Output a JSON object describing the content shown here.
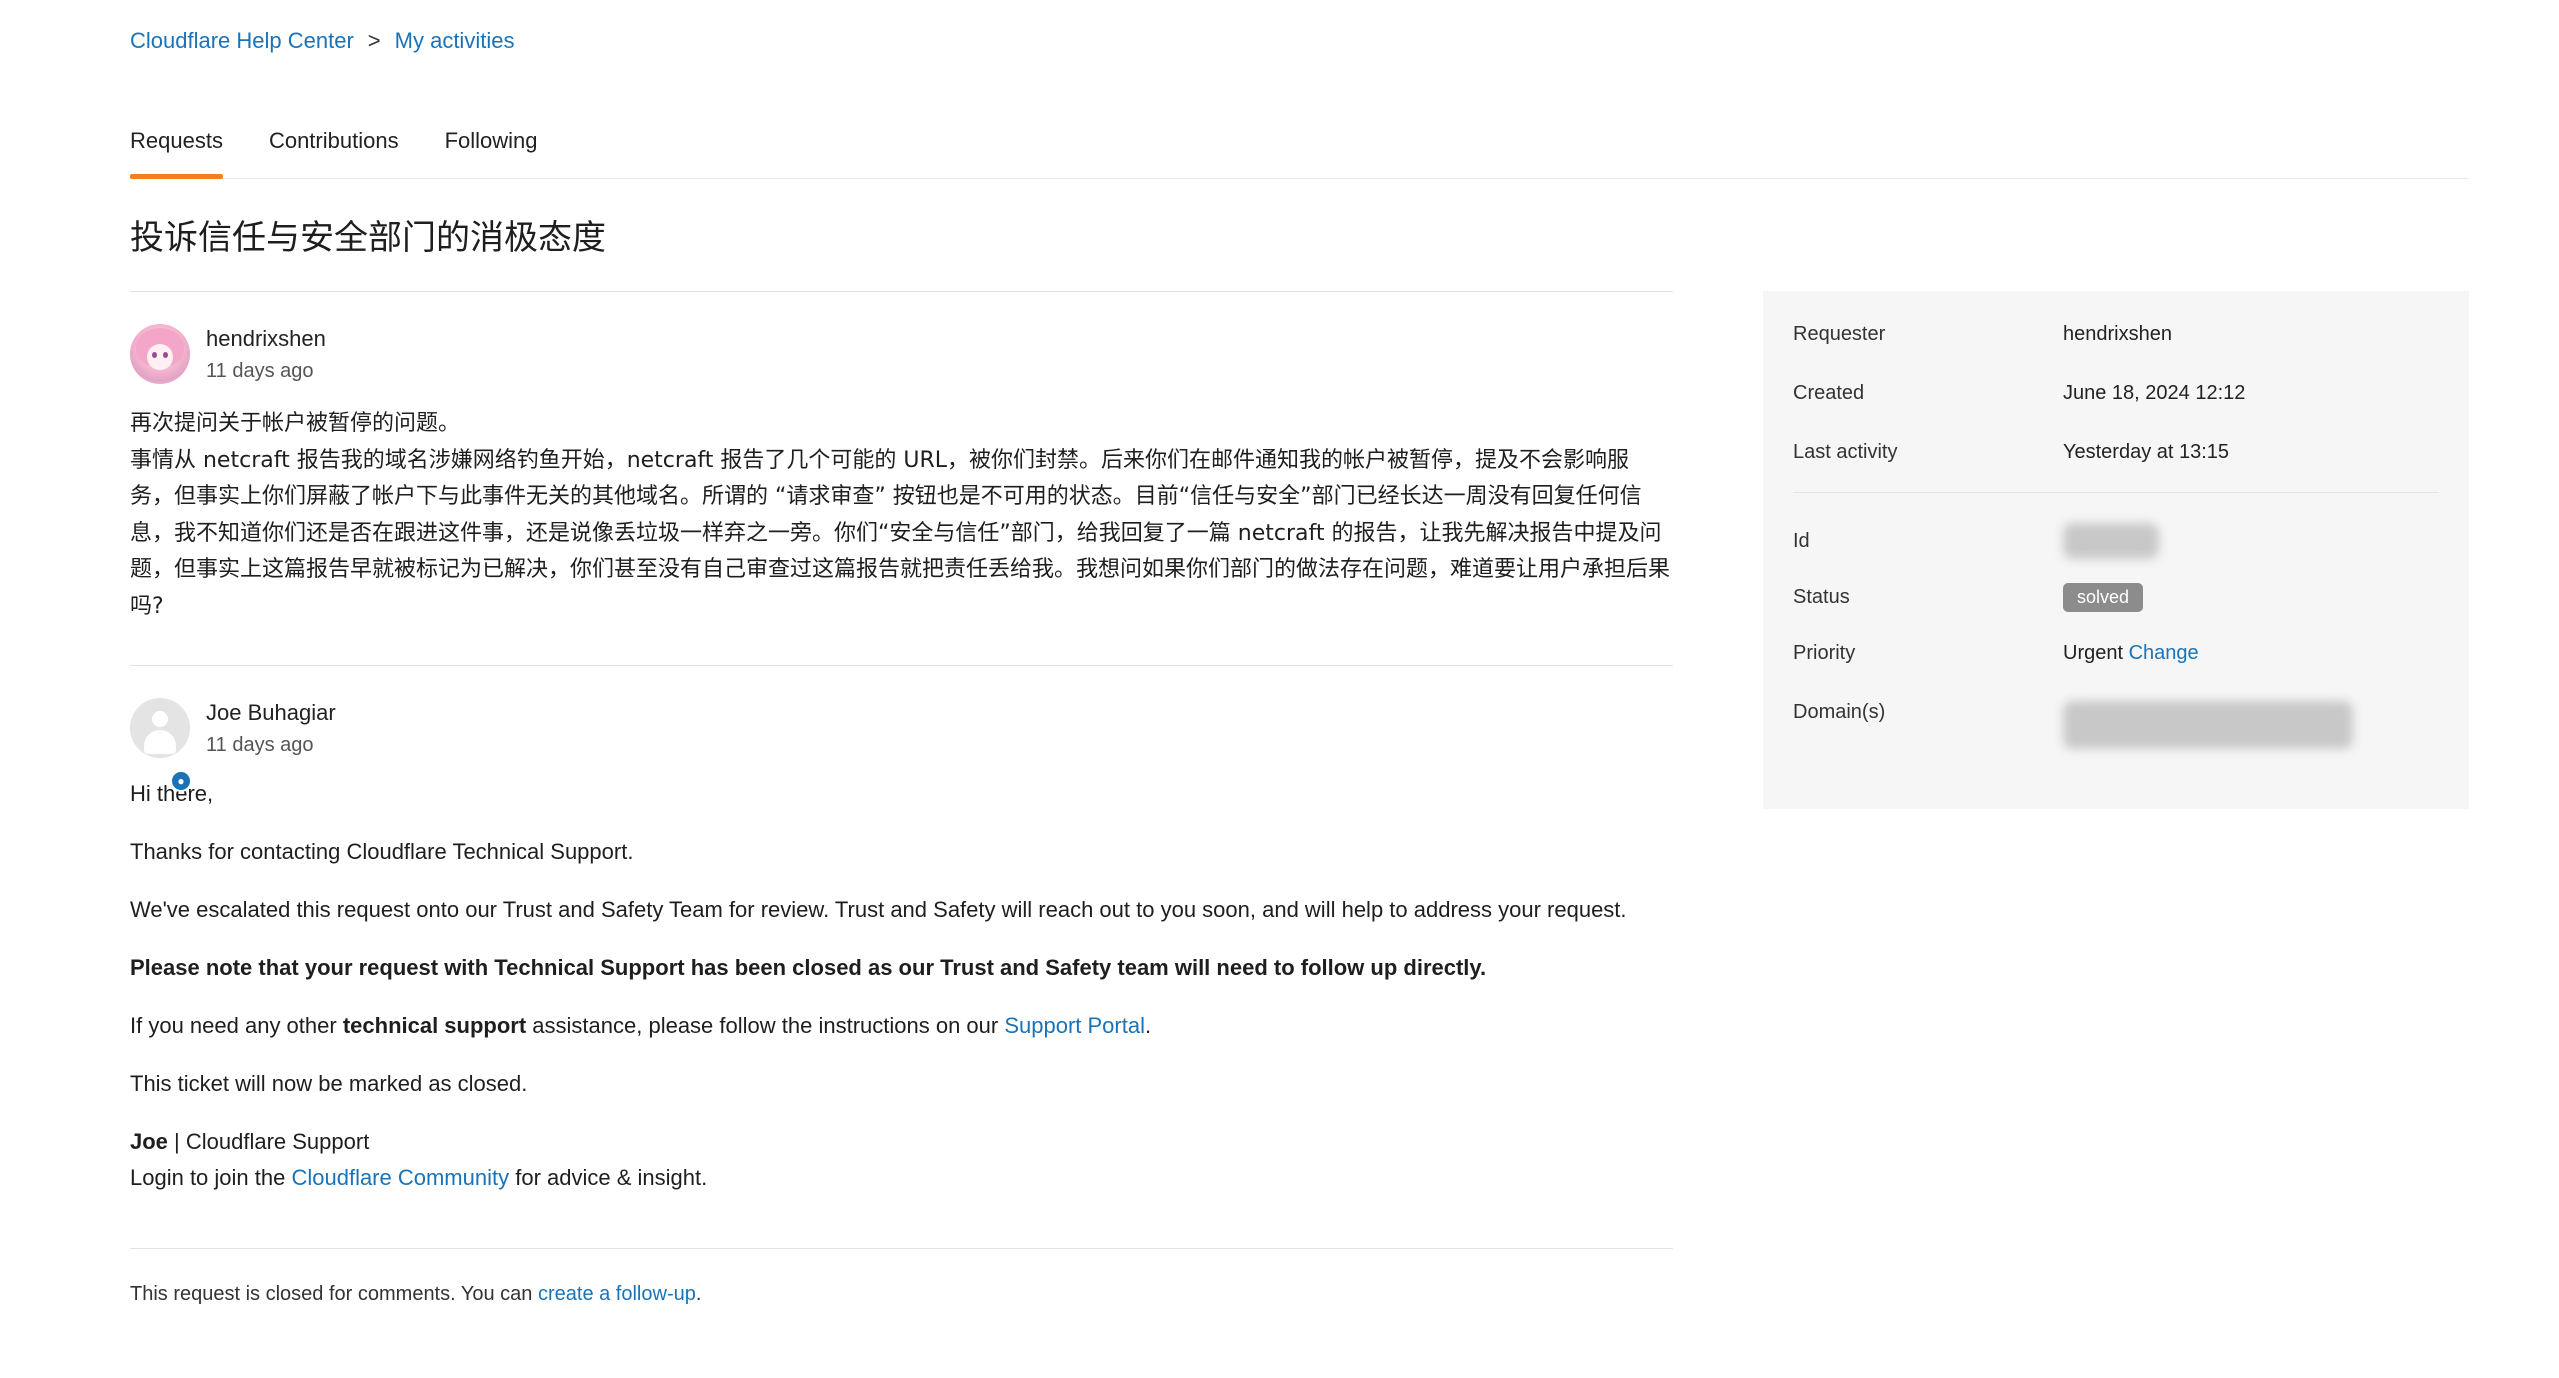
{
  "breadcrumb": {
    "home": "Cloudflare Help Center",
    "sep": ">",
    "current": "My activities"
  },
  "tabs": [
    {
      "label": "Requests",
      "active": true
    },
    {
      "label": "Contributions",
      "active": false
    },
    {
      "label": "Following",
      "active": false
    }
  ],
  "request": {
    "title": "投诉信任与安全部门的消极态度"
  },
  "comments": [
    {
      "author": "hendrixshen",
      "time": "11 days ago",
      "paragraphs": [
        "再次提问关于帐户被暂停的问题。",
        "事情从 netcraft 报告我的域名涉嫌网络钓鱼开始，netcraft 报告了几个可能的 URL，被你们封禁。后来你们在邮件通知我的帐户被暂停，提及不会影响服务，但事实上你们屏蔽了帐户下与此事件无关的其他域名。所谓的 “请求审查” 按钮也是不可用的状态。目前“信任与安全”部门已经长达一周没有回复任何信息，我不知道你们还是否在跟进这件事，还是说像丢垃圾一样弃之一旁。你们“安全与信任”部门，给我回复了一篇 netcraft 的报告，让我先解决报告中提及问题，但事实上这篇报告早就被标记为已解决，你们甚至没有自己审查过这篇报告就把责任丢给我。我想问如果你们部门的做法存在问题，难道要让用户承担后果吗?"
      ]
    },
    {
      "author": "Joe Buhagiar",
      "time": "11 days ago",
      "greeting": "Hi there,",
      "thanks": "Thanks for contacting Cloudflare Technical Support.",
      "escalation": "We've escalated this request onto our Trust and Safety Team for review. Trust and Safety will reach out to you soon, and will help to address your request.",
      "note_bold": "Please note that your request with Technical Support has been closed as our Trust and Safety team will need to follow up directly.",
      "assist_pre": "If you need any other ",
      "assist_bold": "technical support",
      "assist_mid": " assistance, please follow the instructions on our ",
      "assist_link": "Support Portal",
      "assist_end": ".",
      "marked": "This ticket will now be marked as closed.",
      "sig_name": "Joe",
      "sig_rest": " | Cloudflare Support",
      "join_pre": "Login to join the ",
      "join_link": "Cloudflare Community",
      "join_end": " for advice & insight."
    }
  ],
  "closed_note": {
    "text": "This request is closed for comments. You can ",
    "link": "create a follow-up",
    "end": "."
  },
  "sidebar": {
    "requester_label": "Requester",
    "requester": "hendrixshen",
    "created_label": "Created",
    "created": "June 18, 2024 12:12",
    "last_label": "Last activity",
    "last": "Yesterday at 13:15",
    "id_label": "Id",
    "status_label": "Status",
    "status": "solved",
    "priority_label": "Priority",
    "priority": "Urgent",
    "priority_change": "Change",
    "domains_label": "Domain(s)"
  },
  "colors": {
    "accent": "#f38020",
    "link": "#1a73b8",
    "sidebar_bg": "#f6f6f6",
    "solved_badge": "#8c8c8c"
  }
}
